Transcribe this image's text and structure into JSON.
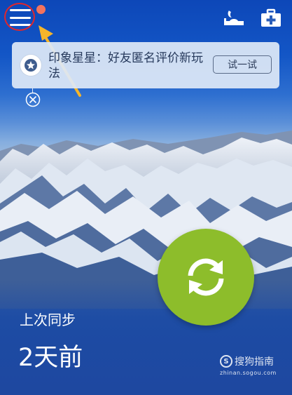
{
  "header": {
    "menu_icon": "hamburger-menu-icon",
    "notification_dot_color": "#f3735e",
    "highlight_ring_color": "#e0262c",
    "arrow_color": "#f5b52a",
    "right_icons": [
      "sleep-icon",
      "first-aid-kit-icon"
    ]
  },
  "banner": {
    "icon": "star-icon",
    "text": "印象星星：好友匿名评价新玩法",
    "action_label": "试一试",
    "close_icon": "close-circle-icon"
  },
  "sync": {
    "button_icon": "sync-arrows-icon",
    "button_color": "#8dbd2b",
    "last_sync_label": "上次同步",
    "last_sync_value": "2天前"
  },
  "watermark": {
    "logo_letter": "S",
    "name": "搜狗指南",
    "url": "zhinan.sogou.com"
  }
}
